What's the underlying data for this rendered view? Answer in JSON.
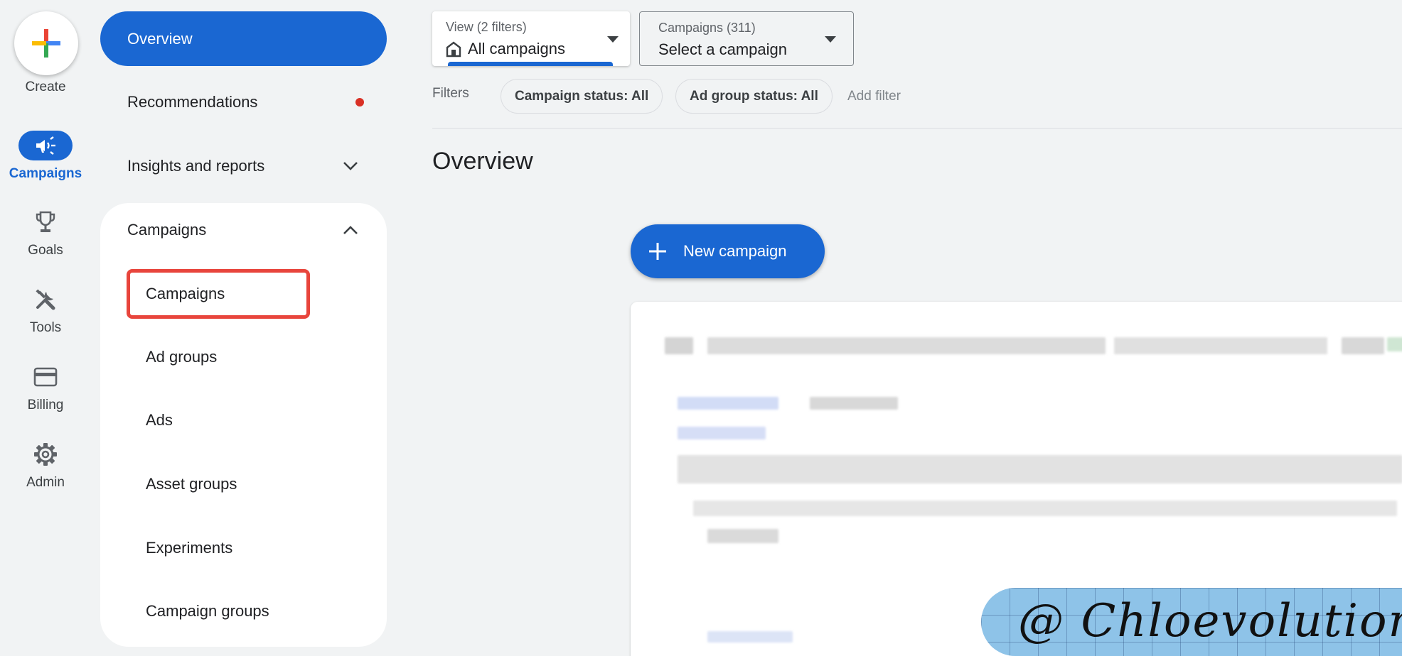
{
  "rail": {
    "create_label": "Create",
    "items": [
      {
        "label": "Campaigns",
        "icon": "megaphone-icon"
      },
      {
        "label": "Goals",
        "icon": "trophy-icon"
      },
      {
        "label": "Tools",
        "icon": "tools-icon"
      },
      {
        "label": "Billing",
        "icon": "credit-card-icon"
      },
      {
        "label": "Admin",
        "icon": "gear-icon"
      }
    ]
  },
  "nav": {
    "overview": "Overview",
    "recommendations": "Recommendations",
    "insights": "Insights and reports",
    "campaigns_section": "Campaigns",
    "sub_items": [
      "Campaigns",
      "Ad groups",
      "Ads",
      "Asset groups",
      "Experiments",
      "Campaign groups"
    ]
  },
  "selectors": {
    "view_small": "View (2 filters)",
    "view_big": "All campaigns",
    "campaigns_small": "Campaigns (311)",
    "campaigns_big": "Select a campaign"
  },
  "filters": {
    "label": "Filters",
    "chips": [
      "Campaign status: All",
      "Ad group status: All"
    ],
    "add_filter": "Add filter"
  },
  "main": {
    "title": "Overview",
    "new_campaign": "New campaign"
  },
  "watermark": "@ Chloevolution",
  "colors": {
    "primary": "#1a67d2",
    "highlight_border": "#e8453c",
    "notification_dot": "#d93025"
  }
}
